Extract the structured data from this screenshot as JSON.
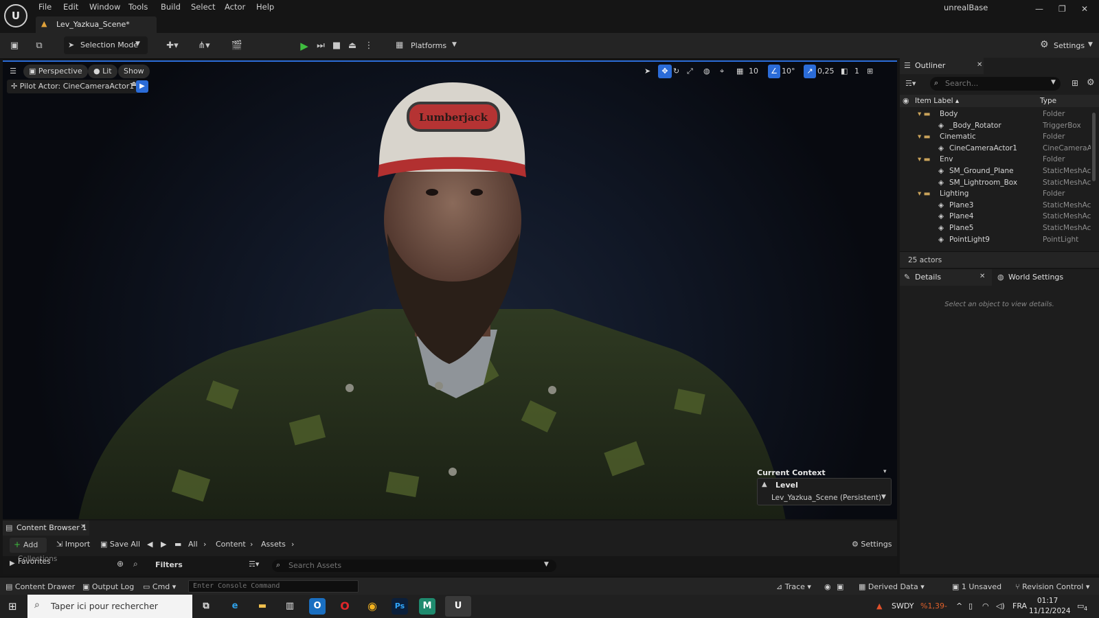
{
  "menu": [
    "File",
    "Edit",
    "Window",
    "Tools",
    "Build",
    "Select",
    "Actor",
    "Help"
  ],
  "app_name": "unrealBase",
  "document_tab": "Lev_Yazkua_Scene*",
  "toolbar": {
    "selection_mode": "Selection Mode",
    "platforms": "Platforms",
    "settings": "Settings"
  },
  "viewport": {
    "perspective": "Perspective",
    "lit": "Lit",
    "show": "Show",
    "pilot": "Pilot Actor: CineCameraActor1",
    "grid_size": "10",
    "angle_snap": "10°",
    "scale_snap": "0,25",
    "camera_speed": "1",
    "cap_text": "Lumberjack",
    "current_context_title": "Current Context",
    "context_level": "Level",
    "context_value": "Lev_Yazkua_Scene (Persistent)"
  },
  "outliner": {
    "tab": "Outliner",
    "search_placeholder": "Search...",
    "col_label": "Item Label ▴",
    "col_type": "Type",
    "rows": [
      {
        "label": "Body",
        "type": "Folder"
      },
      {
        "label": "_Body_Rotator",
        "type": "TriggerBox"
      },
      {
        "label": "Cinematic",
        "type": "Folder"
      },
      {
        "label": "CineCameraActor1",
        "type": "CineCameraA"
      },
      {
        "label": "Env",
        "type": "Folder"
      },
      {
        "label": "SM_Ground_Plane",
        "type": "StaticMeshAc"
      },
      {
        "label": "SM_Lightroom_Box",
        "type": "StaticMeshAc"
      },
      {
        "label": "Lighting",
        "type": "Folder"
      },
      {
        "label": "Plane3",
        "type": "StaticMeshAc"
      },
      {
        "label": "Plane4",
        "type": "StaticMeshAc"
      },
      {
        "label": "Plane5",
        "type": "StaticMeshAc"
      },
      {
        "label": "PointLight9",
        "type": "PointLight"
      }
    ],
    "count": "25 actors"
  },
  "details": {
    "tab": "Details",
    "world_tab": "World Settings",
    "hint": "Select an object to view details."
  },
  "content_browser": {
    "tab": "Content Browser 1",
    "add": "Add",
    "import": "Import",
    "save_all": "Save All",
    "path": [
      "All",
      "Content",
      "Assets"
    ],
    "settings": "Settings",
    "favorites": "Favorites",
    "collections": "Collections",
    "filters": "Filters",
    "search_placeholder": "Search Assets"
  },
  "status_bar": {
    "content_drawer": "Content Drawer",
    "output_log": "Output Log",
    "cmd": "Cmd",
    "console_placeholder": "Enter Console Command",
    "trace": "Trace",
    "derived_data": "Derived Data",
    "unsaved": "1 Unsaved",
    "revision_control": "Revision Control"
  },
  "taskbar": {
    "search": "Taper ici pour rechercher",
    "stock_name": "SWDY",
    "stock_change": "%1,39-",
    "lang": "FRA",
    "time": "01:17",
    "date": "11/12/2024",
    "notif_count": "4"
  }
}
